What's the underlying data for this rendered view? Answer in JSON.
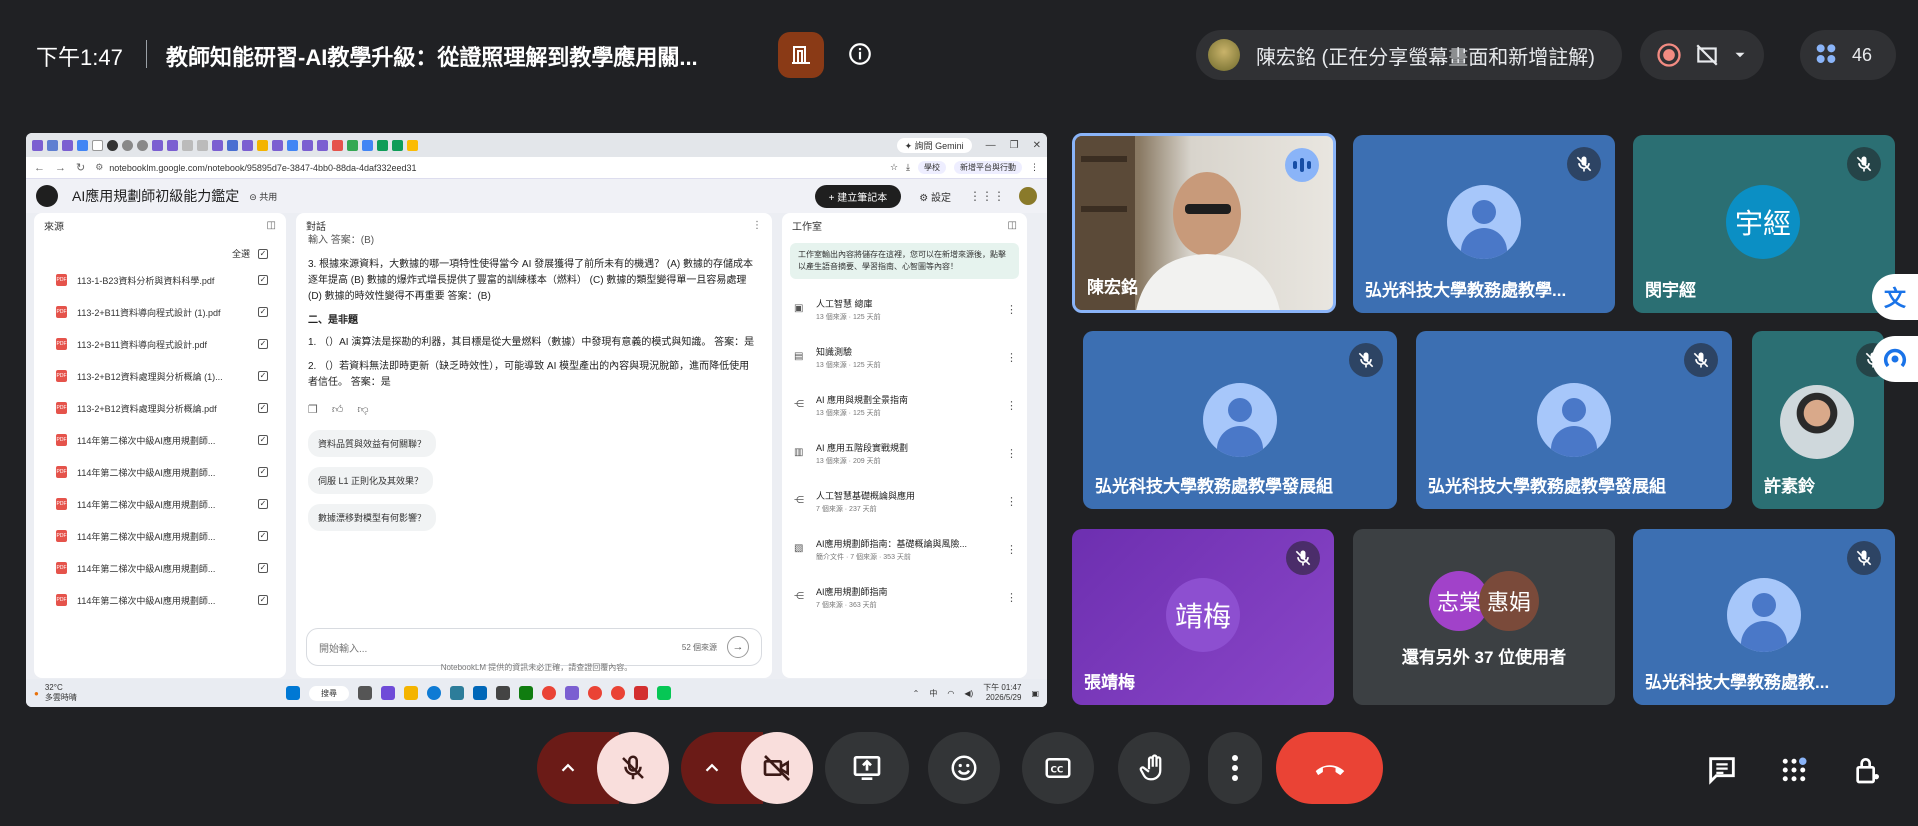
{
  "topbar": {
    "time": "下午1:47",
    "meeting_title": "教師知能研習-AI教學升級：從證照理解到教學應用關...",
    "presenter": "陳宏銘 (正在分享螢幕畫面和新增註解)",
    "participant_count": "46"
  },
  "shared_screen": {
    "gemini_tab": "✦ 詢問 Gemini",
    "url": "notebooklm.google.com/notebook/95895d7e-3847-4bb0-88da-4daf332eed31",
    "profile_chip": "學校",
    "extension_chip": "新增平台與行動",
    "notebook_title": "AI應用規劃師初級能力鑑定",
    "share_label": "⊝ 共用",
    "create_notebook": "+ 建立筆記本",
    "settings_label": "⚙ 設定",
    "sources": {
      "header": "來源",
      "select_all": "全選",
      "items": [
        "113-1-B23資料分析與資料科學.pdf",
        "113-2+B11資料導向程式設計 (1).pdf",
        "113-2+B11資料導向程式設計.pdf",
        "113-2+B12資料處理與分析概論 (1)...",
        "113-2+B12資料處理與分析概論.pdf",
        "114年第二梯次中級AI應用規劃師...",
        "114年第二梯次中級AI應用規劃師...",
        "114年第二梯次中級AI應用規劃師...",
        "114年第二梯次中級AI應用規劃師...",
        "114年第二梯次中級AI應用規劃師...",
        "114年第二梯次中級AI應用規劃師..."
      ]
    },
    "chat": {
      "header": "對話",
      "cut_line": "輸入 答案：(B)",
      "q3": "3. 根據來源資料，大數據的哪一項特性使得當今 AI 發展獲得了前所未有的機遇？ (A) 數據的存儲成本逐年提高 (B) 數據的爆炸式增長提供了豐富的訓練樣本（燃料） (C) 數據的類型變得單一且容易處理 (D) 數據的時效性變得不再重要 答案：(B)",
      "section_title": "二、是非題",
      "tf1": "1. （）AI 演算法是探勘的利器，其目標是從大量燃料（數據）中發現有意義的模式與知識。 答案：是",
      "tf2": "2. （）若資料無法即時更新（缺乏時效性），可能導致 AI 模型產出的內容與現況脫節，進而降低使用者信任。 答案：是",
      "suggestions": [
        "資料品質與效益有何關聯？",
        "伺服 L1 正則化及其效果？",
        "數據漂移對模型有何影響？"
      ],
      "input_placeholder": "開始輸入...",
      "source_count": "52 個來源"
    },
    "studio": {
      "header": "工作室",
      "banner": "工作室輸出內容將儲存在這裡，您可以在新增來源後，點擊以產生語音摘要、學習指南、心智圖等內容！",
      "items": [
        {
          "title": "人工智慧 總庫",
          "meta": "13 個來源 · 125 天前"
        },
        {
          "title": "知識測驗",
          "meta": "13 個來源 · 125 天前"
        },
        {
          "title": "AI 應用與規劃全景指南",
          "meta": "13 個來源 · 125 天前"
        },
        {
          "title": "AI 應用五階段實戰規劃",
          "meta": "13 個來源 · 209 天前"
        },
        {
          "title": "人工智慧基礎概論與應用",
          "meta": "7 個來源 · 237 天前"
        },
        {
          "title": "AI應用規劃師指南：基礎概論與風險...",
          "meta": "簡介文件 · 7 個來源 · 353 天前"
        },
        {
          "title": "AI應用規劃師指南",
          "meta": "7 個來源 · 363 天前"
        }
      ]
    },
    "disclaimer": "NotebookLM 提供的資訊未必正確，請查證回覆內容。",
    "taskbar": {
      "temp": "32°C",
      "weather": "多雲時晴",
      "search": "搜尋",
      "ime": "中",
      "time": "下午 01:47",
      "date": "2026/5/29"
    }
  },
  "tiles": [
    {
      "name": "陳宏銘"
    },
    {
      "name": "弘光科技大學教務處教學..."
    },
    {
      "name": "閔宇經",
      "initials": "宇經"
    },
    {
      "name": "弘光科技大學教務處教學發展組"
    },
    {
      "name": "弘光科技大學教務處教學發展組"
    },
    {
      "name": "許素鈴"
    },
    {
      "name": "張靖梅",
      "initials": "靖梅"
    },
    {
      "name": "還有另外 37 位使用者",
      "initials_a": "志棠",
      "initials_b": "惠娟"
    },
    {
      "name": "弘光科技大學教務處教..."
    }
  ],
  "colors": {
    "background": "#202124",
    "mic_off_red": "#6b1b17",
    "end_call": "#ea4335",
    "tile_blue": "#3c6fb2",
    "tile_teal": "#2b6f73",
    "tile_purple": "#7a35b8"
  }
}
